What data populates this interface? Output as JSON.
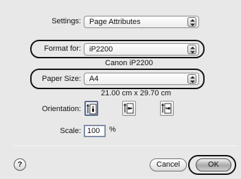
{
  "settings": {
    "label": "Settings:",
    "value": "Page Attributes"
  },
  "format_for": {
    "label": "Format for:",
    "value": "iP2200",
    "subtext": "Canon iP2200"
  },
  "paper_size": {
    "label": "Paper Size:",
    "value": "A4",
    "subtext": "21.00 cm x 29.70 cm"
  },
  "orientation": {
    "label": "Orientation:",
    "options": [
      {
        "name": "portrait",
        "selected": true
      },
      {
        "name": "landscape-left",
        "selected": false
      },
      {
        "name": "landscape-right",
        "selected": false
      }
    ]
  },
  "scale": {
    "label": "Scale:",
    "value": "100",
    "unit": "%"
  },
  "buttons": {
    "help": "?",
    "cancel": "Cancel",
    "ok": "OK"
  }
}
